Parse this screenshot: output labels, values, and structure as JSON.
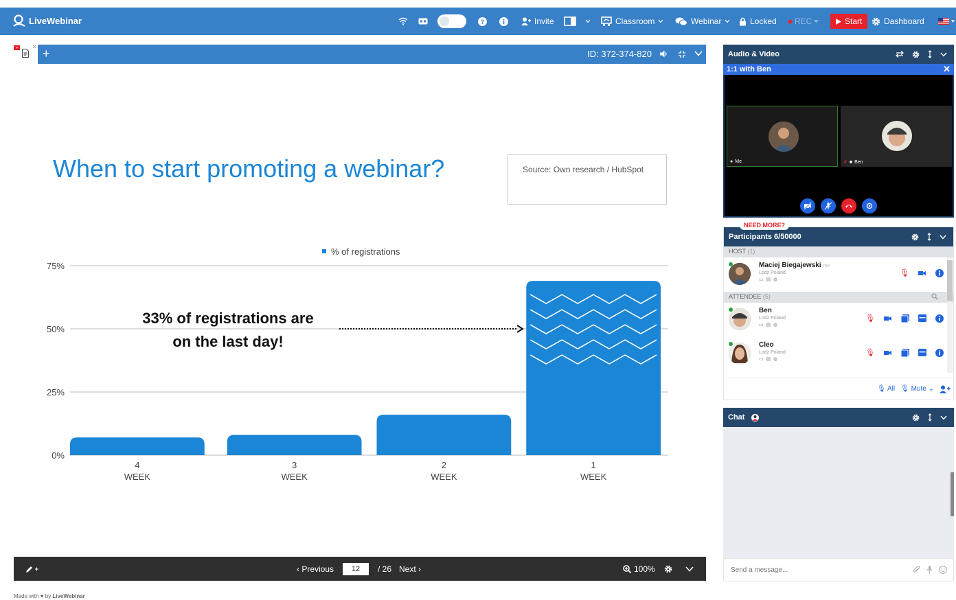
{
  "topbar": {
    "brand": "LiveWebinar",
    "invite_label": "Invite",
    "classroom_label": "Classroom",
    "webinar_label": "Webinar",
    "locked_label": "Locked",
    "rec_label": "REC",
    "start_label": "Start",
    "dashboard_label": "Dashboard",
    "accent": "#3880c8"
  },
  "presentation": {
    "meeting_id": "ID: 372-374-820",
    "add_tab": "+",
    "slide_title": "When to start promoting a webinar?",
    "source_note": "Source: Own research / HubSpot",
    "callout_line1": "33% of registrations are",
    "callout_line2": "on the last day!",
    "previous_label": "‹ Previous",
    "page_value": "12",
    "page_total": "/ 26",
    "next_label": "Next ›",
    "zoom": "100%"
  },
  "chart_data": {
    "type": "bar",
    "legend": [
      "% of registrations"
    ],
    "legend_position": "top-center",
    "categories": [
      "4\nWEEK",
      "3\nWEEK",
      "2\nWEEK",
      "1\nWEEK"
    ],
    "category_numbers": [
      "4",
      "3",
      "2",
      "1"
    ],
    "category_unit": "WEEK",
    "series": [
      {
        "name": "% of registrations",
        "values": [
          7,
          8,
          16,
          69
        ]
      }
    ],
    "ytick_labels": [
      "75%",
      "50%",
      "25%",
      "0%"
    ],
    "yticks": [
      75,
      50,
      25,
      0
    ],
    "ylim": [
      0,
      75
    ],
    "grid": true,
    "bar_color": "#1b86d6"
  },
  "footer": {
    "made_with": "Made with",
    "by": "by",
    "brand": "LiveWebinar"
  },
  "av_panel": {
    "title": "Audio & Video",
    "sub_title": "1:1 with Ben",
    "me_label": "Me",
    "ben_label": "Ben"
  },
  "participants": {
    "need_more": "NEED MORE?",
    "title": "Participants 6/50000",
    "host_section": "HOST",
    "host_count": "(1)",
    "attendee_section": "ATTENDEE",
    "attendee_count": "(5)",
    "me_tag": "me",
    "list": [
      {
        "name": "Maciej Biegajewski",
        "location": "Lodz Poland",
        "section": "host"
      },
      {
        "name": "Ben",
        "location": "Lodz Poland",
        "section": "attendee"
      },
      {
        "name": "Cleo",
        "location": "Lodz Poland",
        "section": "attendee"
      }
    ],
    "all_label": "All",
    "mute_label": "Mute"
  },
  "chat": {
    "title": "Chat",
    "placeholder": "Send a message..."
  }
}
